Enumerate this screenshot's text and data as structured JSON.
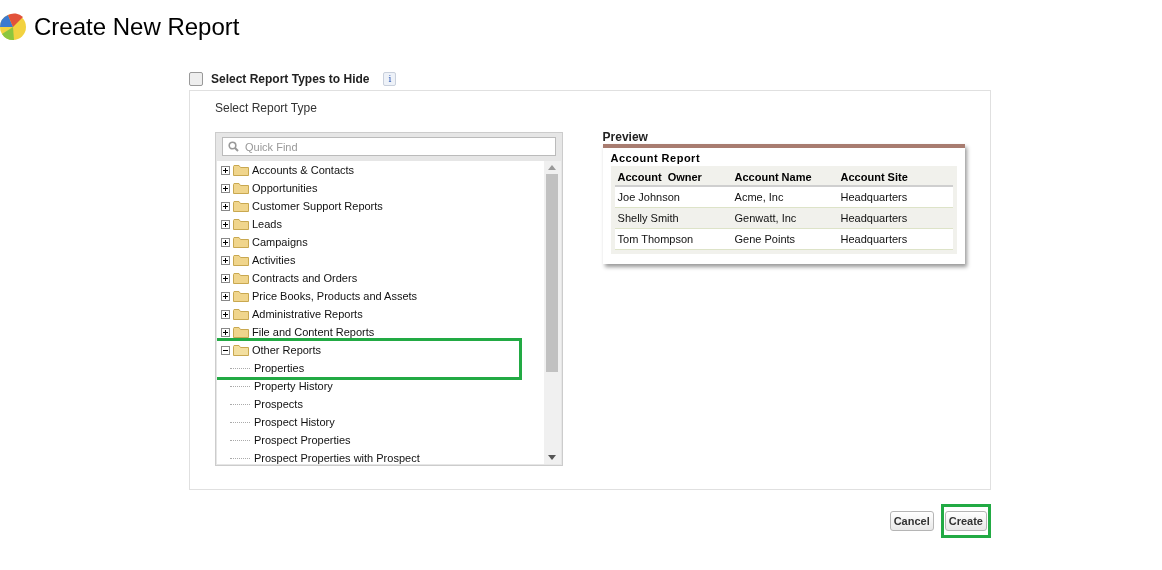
{
  "page_title": "Create New Report",
  "hide_types": {
    "label": "Select Report Types to Hide",
    "checked": false,
    "info": "i"
  },
  "section_label": "Select Report Type",
  "quick_find": {
    "placeholder": "Quick Find"
  },
  "tree": [
    {
      "label": "Accounts & Contacts",
      "expanded": false
    },
    {
      "label": "Opportunities",
      "expanded": false
    },
    {
      "label": "Customer Support Reports",
      "expanded": false
    },
    {
      "label": "Leads",
      "expanded": false
    },
    {
      "label": "Campaigns",
      "expanded": false
    },
    {
      "label": "Activities",
      "expanded": false
    },
    {
      "label": "Contracts and Orders",
      "expanded": false
    },
    {
      "label": "Price Books, Products and Assets",
      "expanded": false
    },
    {
      "label": "Administrative Reports",
      "expanded": false
    },
    {
      "label": "File and Content Reports",
      "expanded": false
    },
    {
      "label": "Other Reports",
      "expanded": true,
      "highlighted": true,
      "children": [
        {
          "label": "Properties",
          "highlighted": true
        },
        {
          "label": "Property History"
        },
        {
          "label": "Prospects"
        },
        {
          "label": "Prospect History"
        },
        {
          "label": "Prospect Properties"
        },
        {
          "label": "Prospect Properties with Prospect"
        }
      ]
    }
  ],
  "preview": {
    "heading": "Preview",
    "report_title": "Account Report",
    "columns": [
      "Account  Owner",
      "Account Name",
      "Account Site"
    ],
    "rows": [
      [
        "Joe Johnson",
        "Acme, Inc",
        "Headquarters"
      ],
      [
        "Shelly Smith",
        "Genwatt, Inc",
        "Headquarters"
      ],
      [
        "Tom Thompson",
        "Gene Points",
        "Headquarters"
      ]
    ]
  },
  "buttons": [
    {
      "label": "Cancel",
      "highlighted": false
    },
    {
      "label": "Create",
      "highlighted": true
    }
  ]
}
